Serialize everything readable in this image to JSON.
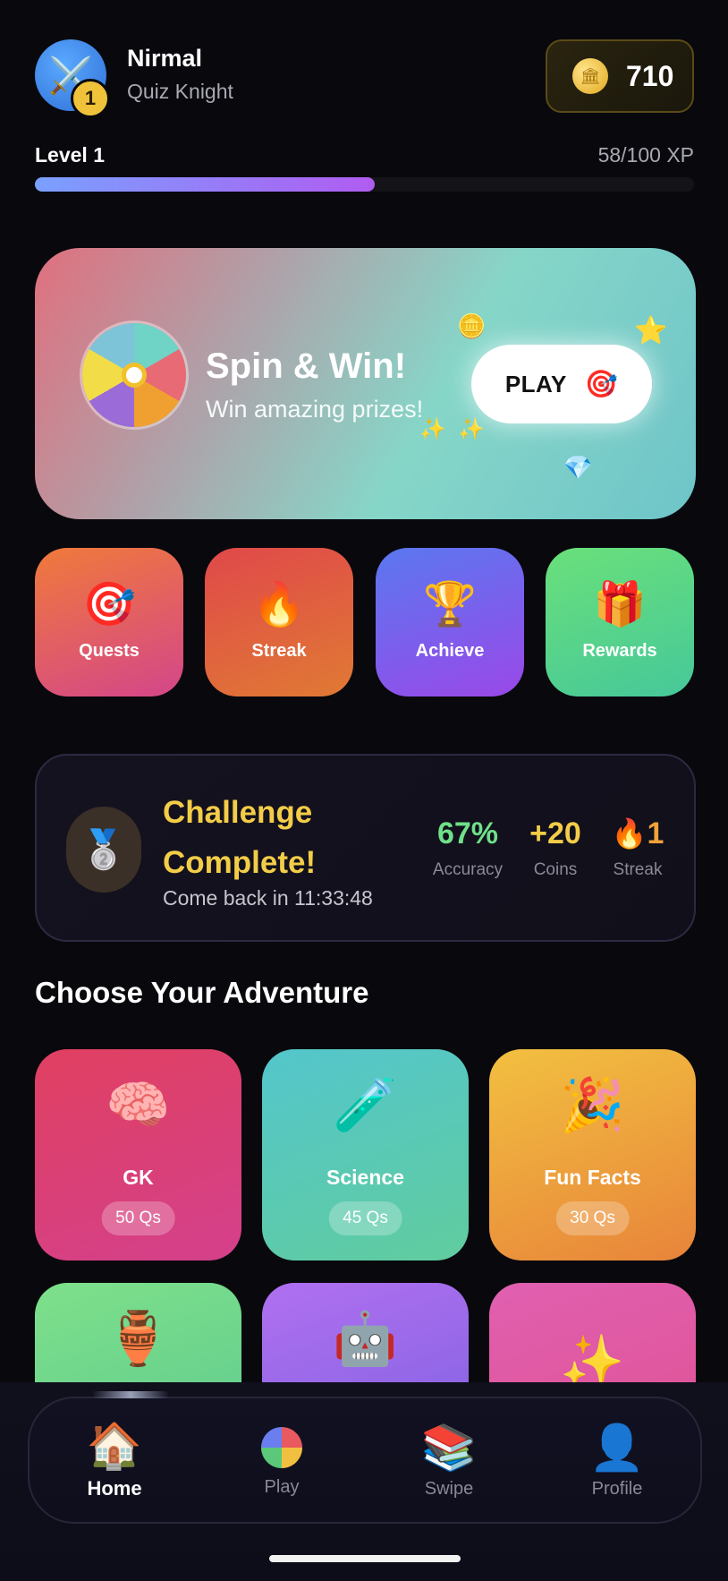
{
  "user": {
    "name": "Nirmal",
    "title": "Quiz Knight",
    "avatar_icon": "crossed-swords-icon",
    "level_badge": "1",
    "coins": "710"
  },
  "level": {
    "label": "Level 1",
    "xp": "58/100 XP",
    "progress": 0.58
  },
  "promo": {
    "title": "Spin & Win!",
    "subtitle": "Win amazing prizes!",
    "play_label": "PLAY"
  },
  "quick_actions": [
    {
      "label": "Quests",
      "icon": "target-icon"
    },
    {
      "label": "Streak",
      "icon": "fire-icon"
    },
    {
      "label": "Achieve",
      "icon": "trophy-icon"
    },
    {
      "label": "Rewards",
      "icon": "gift-icon"
    }
  ],
  "challenge": {
    "title": "Challenge Complete!",
    "subtitle": "Come back in 11:33:48",
    "stats": [
      {
        "value": "67%",
        "label": "Accuracy",
        "color": "#6ee08a"
      },
      {
        "value": "+20",
        "label": "Coins",
        "color": "#f3cd48"
      },
      {
        "value": "1",
        "label": "Streak",
        "color": "#f2a23a"
      }
    ]
  },
  "section_title": "Choose Your Adventure",
  "categories": [
    {
      "name": "GK",
      "count": "50 Qs",
      "icon": "brain-icon"
    },
    {
      "name": "Science",
      "count": "45 Qs",
      "icon": "test-tube-icon"
    },
    {
      "name": "Fun Facts",
      "count": "30 Qs",
      "icon": "party-popper-icon"
    },
    {
      "name": "",
      "count": "",
      "icon": "amphora-icon"
    },
    {
      "name": "",
      "count": "",
      "icon": "robot-icon"
    },
    {
      "name": "",
      "count": "",
      "icon": "sparkles-icon"
    }
  ],
  "nav": [
    {
      "label": "Home",
      "icon": "house-icon",
      "active": true
    },
    {
      "label": "Play",
      "icon": "color-wheel-icon",
      "active": false
    },
    {
      "label": "Swipe",
      "icon": "books-icon",
      "active": false
    },
    {
      "label": "Profile",
      "icon": "person-icon",
      "active": false
    }
  ]
}
